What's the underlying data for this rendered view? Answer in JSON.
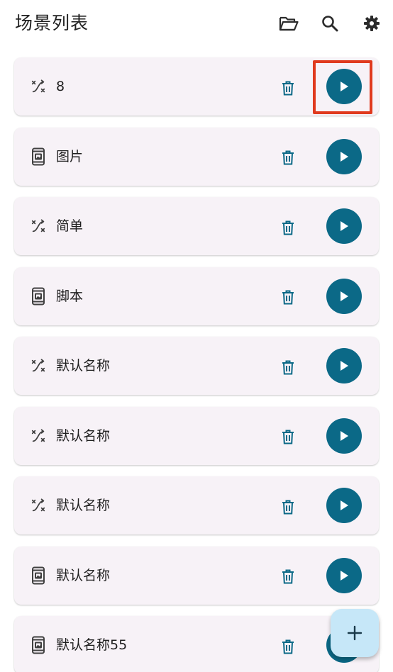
{
  "header": {
    "title": "场景列表",
    "icons": [
      "folder-open-icon",
      "search-icon",
      "gear-icon"
    ]
  },
  "colors": {
    "accent": "#0b6987",
    "card_bg": "#f7f2f7",
    "fab_bg": "#c6e7f8",
    "highlight": "#e03a1e"
  },
  "scenes": [
    {
      "label": "8",
      "icon": "shuffle-icon"
    },
    {
      "label": "图片",
      "icon": "phone-image-icon"
    },
    {
      "label": "简单",
      "icon": "shuffle-icon"
    },
    {
      "label": "脚本",
      "icon": "phone-image-icon"
    },
    {
      "label": "默认名称",
      "icon": "shuffle-icon"
    },
    {
      "label": "默认名称",
      "icon": "shuffle-icon"
    },
    {
      "label": "默认名称",
      "icon": "shuffle-icon"
    },
    {
      "label": "默认名称",
      "icon": "phone-image-icon"
    },
    {
      "label": "默认名称55",
      "icon": "phone-image-icon"
    }
  ],
  "fab": {
    "label": "+",
    "icon": "add-icon"
  }
}
